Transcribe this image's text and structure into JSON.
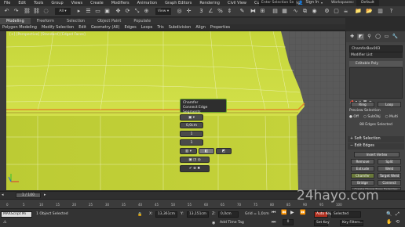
{
  "menubar": {
    "items": [
      "File",
      "Edit",
      "Tools",
      "Group",
      "Views",
      "Create",
      "Modifiers",
      "Animation",
      "Graph Editors",
      "Rendering",
      "Civil View",
      "Customize",
      "Scripting"
    ],
    "search_label": "Enter Selection Se",
    "sign_in": "Sign In",
    "workspaces_label": "Workspaces:",
    "workspaces_value": "Default"
  },
  "ribbon": {
    "tabs": [
      "Modeling",
      "Freeform",
      "Selection",
      "Object Paint",
      "Populate"
    ],
    "active_tab": "Modeling",
    "items": [
      "Polygon Modeling",
      "Modify Selection",
      "Edit",
      "Geometry (All)",
      "Edges",
      "Loops",
      "Tris",
      "Subdivision",
      "Align",
      "Properties"
    ]
  },
  "viewport": {
    "label": "[+] [Perspective] [Standard] [Edged Faces]",
    "quad_title": "Chamfer",
    "quad_subtitle": "Connect Edge Segments",
    "field_amount": "0,0cm",
    "field_segments": "1"
  },
  "command_panel": {
    "object_name": "ChamferBox003",
    "modifier_list": "Modifier List",
    "stack_item": "Editable Poly",
    "ring_label": "Ring",
    "loop_label": "Loop",
    "preview_selection": "Preview Selection",
    "off_label": "Off",
    "subobj_label": "SubObj",
    "multi_label": "Multi",
    "edges_selected": "88 Edges Selected",
    "soft_selection": "Soft Selection",
    "edit_edges": "Edit Edges",
    "insert_vertex": "Insert Vertex",
    "remove": "Remove",
    "split": "Split",
    "extrude": "Extrude",
    "weld": "Weld",
    "chamfer": "Chamfer",
    "target_weld": "Target Weld",
    "bridge": "Bridge",
    "connect": "Connect",
    "create_shape": "Create Shape From Selection"
  },
  "timeline": {
    "frame_display": "1 / 100",
    "ticks": [
      "0",
      "5",
      "10",
      "15",
      "20",
      "25",
      "30",
      "35",
      "40",
      "45",
      "50",
      "55",
      "60",
      "65",
      "70",
      "75",
      "80",
      "85",
      "90",
      "95",
      "100"
    ]
  },
  "status": {
    "maxscript": "MAXScript Mi",
    "selected": "1 Object Selected",
    "x_label": "X:",
    "x_value": "13,361cm",
    "y_label": "Y:",
    "y_value": "13,151cm",
    "z_label": "Z:",
    "z_value": "0,0cm",
    "grid": "Grid = 1,0cm",
    "add_time_tag": "Add Time Tag",
    "auto_key": "Auto Key",
    "set_key": "Set Key",
    "selected_dropdown": "Selected",
    "key_filters": "Key Filters...",
    "frame": "0"
  },
  "watermark": "24hayo.com",
  "colors": {
    "mesh": "#c8d83a",
    "ribbon_active": "#4a4a4a",
    "autokey": "#b03020",
    "accent_green": "#6aa22a"
  }
}
